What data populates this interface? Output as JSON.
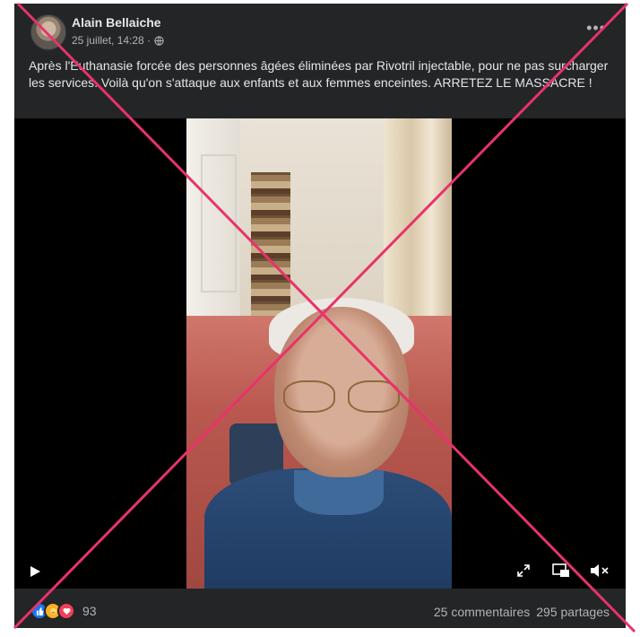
{
  "post": {
    "author": "Alain Bellaiche",
    "timestamp": "25 juillet, 14:28 ·",
    "privacy_icon": "globe-icon",
    "more_label": "•••",
    "text": "Après l'Euthanasie forcée des personnes âgées éliminées par Rivotril injectable, pour ne pas surcharger les services. Voilà qu'on s'attaque aux enfants et aux femmes enceintes. ARRETEZ LE MASSACRE !"
  },
  "video": {
    "controls": [
      "play-icon",
      "fullscreen-icon",
      "picture-in-picture-icon",
      "mute-icon"
    ]
  },
  "footer": {
    "reaction_icons": [
      "like-icon",
      "care-icon",
      "love-icon"
    ],
    "reaction_count": "93",
    "comments": "25 commentaires",
    "shares": "295 partages"
  },
  "colors": {
    "card_bg": "#242526",
    "text_primary": "#e4e6eb",
    "text_secondary": "#b0b3b8",
    "cross_red": "#e8336a"
  }
}
